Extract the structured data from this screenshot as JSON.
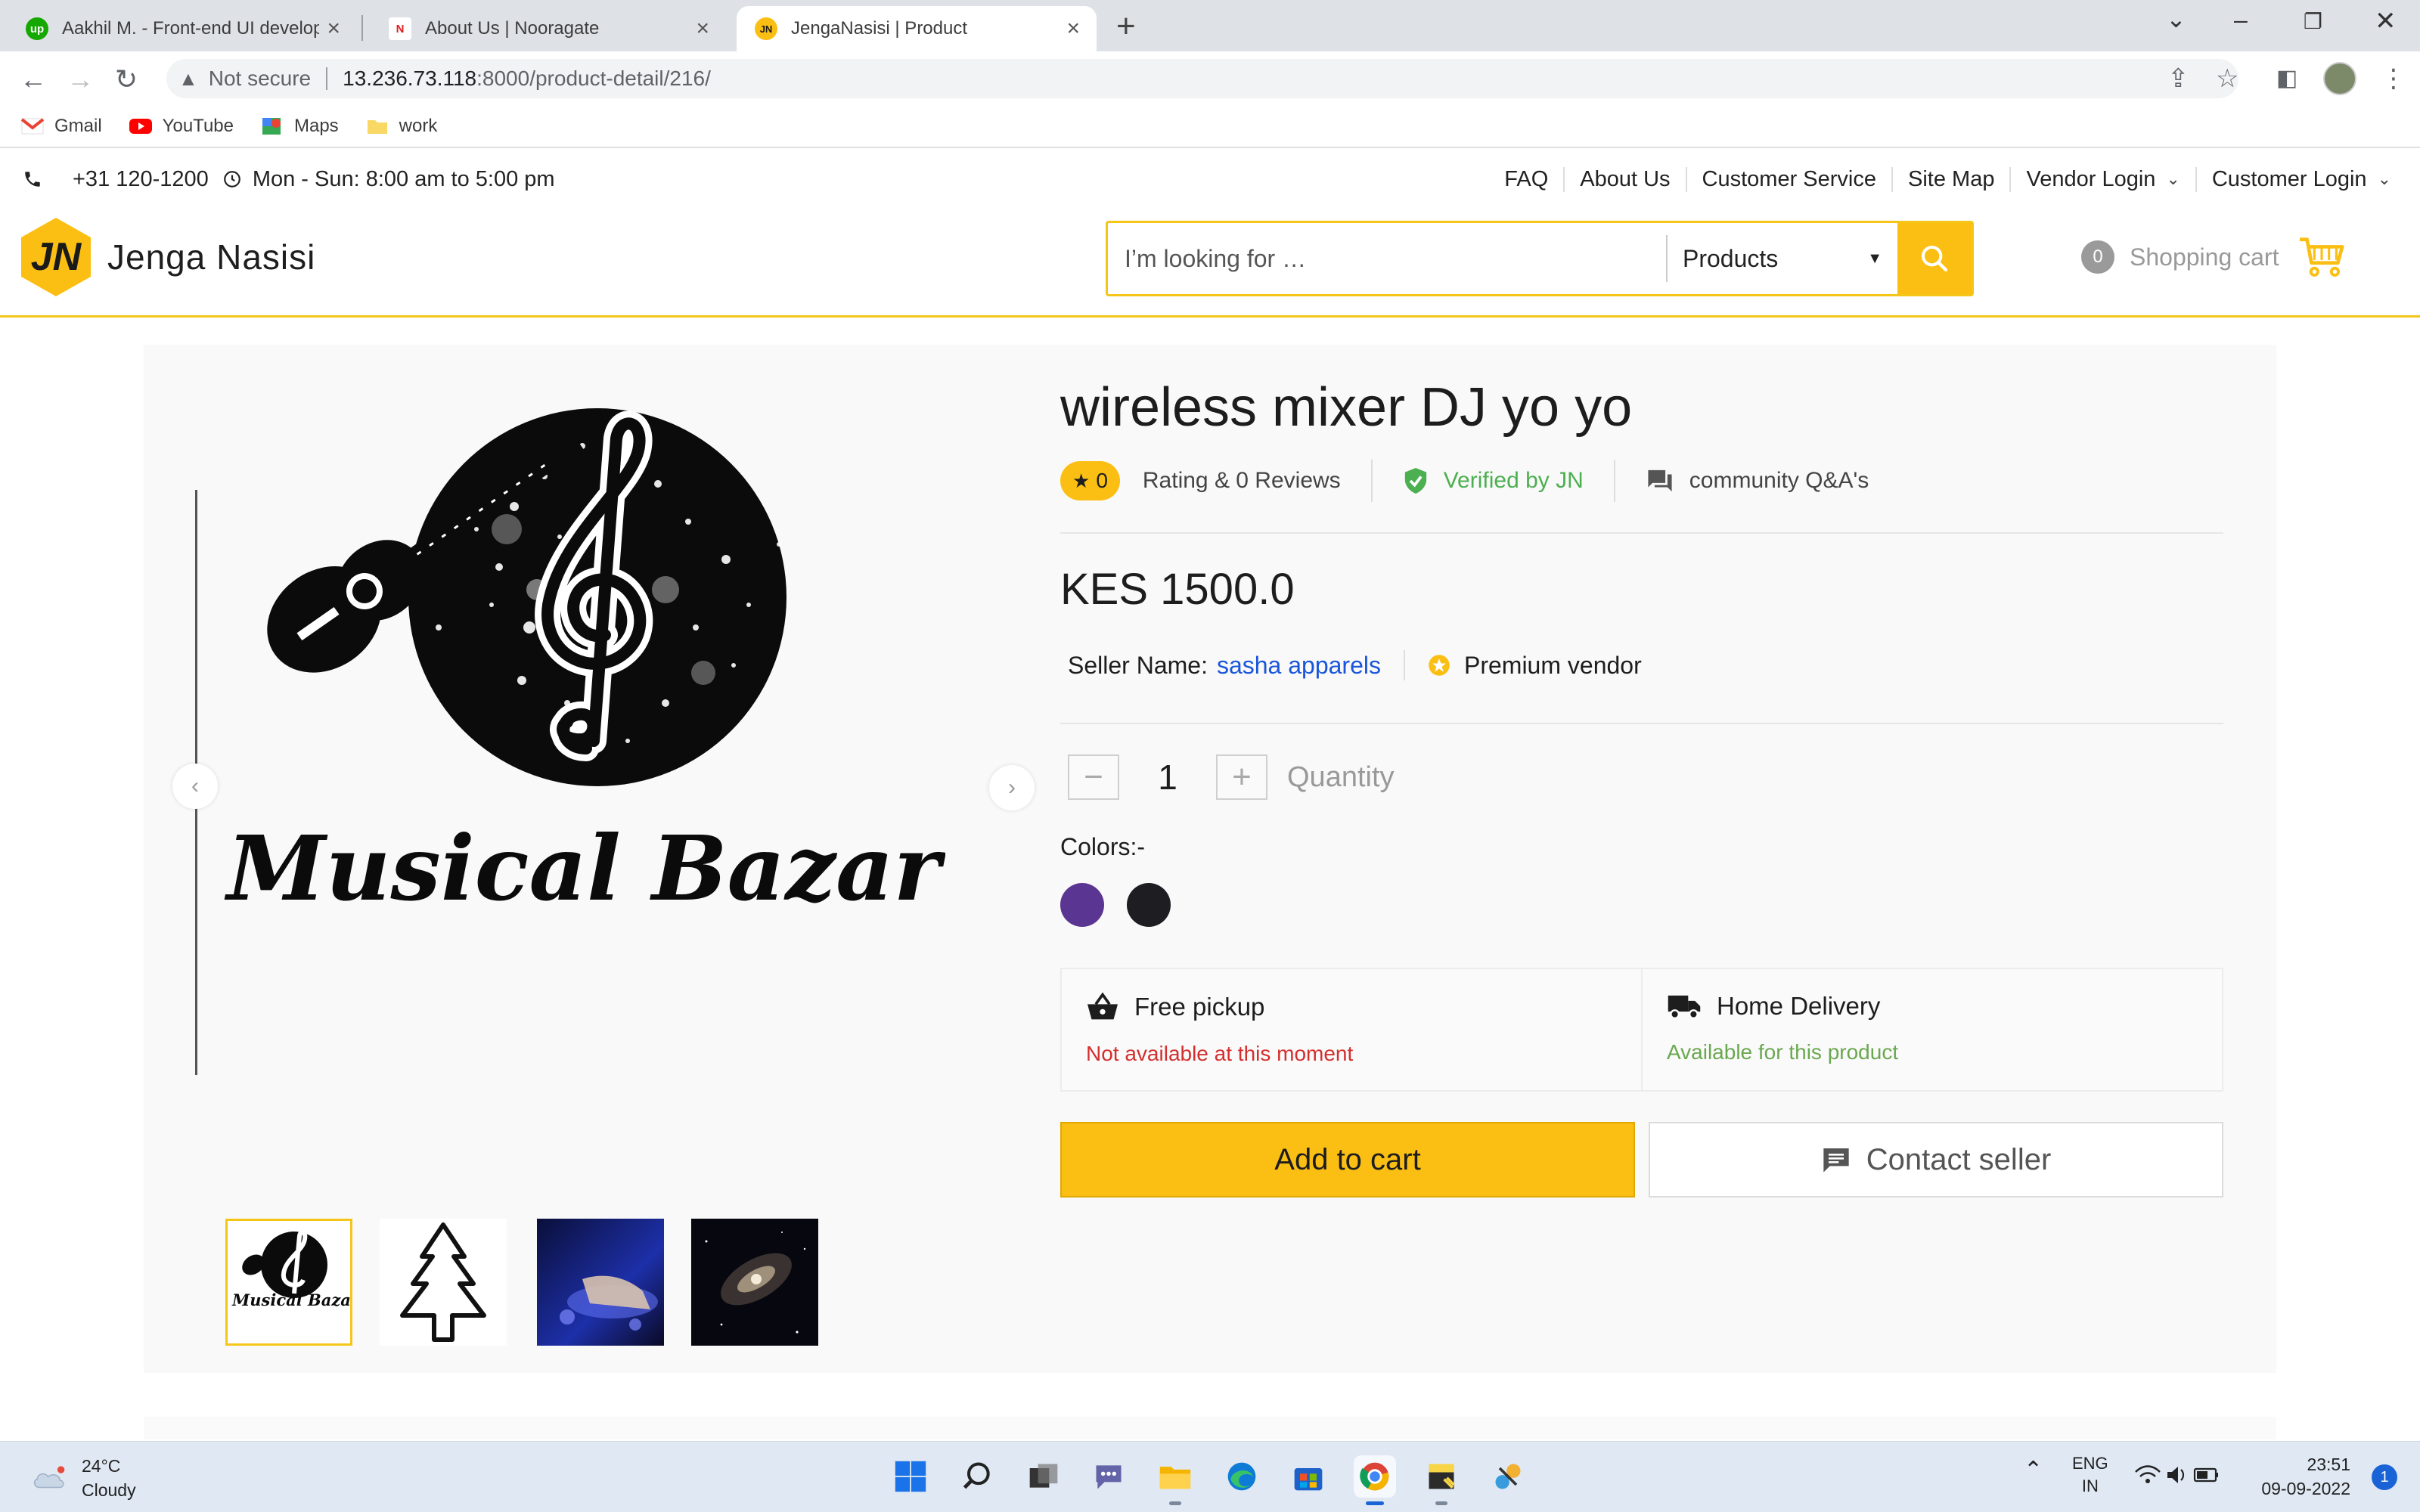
{
  "browser": {
    "tabs": [
      {
        "title": "Aakhil M. - Front-end UI develop",
        "favicon": "up",
        "favicon_color": "#14a800"
      },
      {
        "title": "About Us | Nooragate",
        "favicon": "N",
        "favicon_color": "#e02020"
      },
      {
        "title": "JengaNasisi | Product",
        "favicon": "JN",
        "favicon_color": "#fbbf14"
      }
    ],
    "security_label": "Not secure",
    "url_host": "13.236.73.118",
    "url_rest": ":8000/product-detail/216/",
    "bookmarks": [
      "Gmail",
      "YouTube",
      "Maps",
      "work"
    ]
  },
  "site": {
    "phone": "+31 120-1200",
    "hours": "Mon - Sun: 8:00 am to 5:00 pm",
    "top_links": [
      "FAQ",
      "About Us",
      "Customer Service",
      "Site Map",
      "Vendor Login",
      "Customer Login"
    ],
    "logo_mark": "JN",
    "brand": "Jenga Nasisi",
    "search_placeholder": "I’m looking for …",
    "search_category": "Products",
    "cart_count": "0",
    "cart_label": "Shopping cart",
    "accent": "#fbbf14"
  },
  "product": {
    "title": "wireless mixer DJ yo yo",
    "rating_value": "0",
    "rating_text": "Rating & 0 Reviews",
    "verified_text": "Verified by JN",
    "qa_text": "community Q&A's",
    "price": "KES 1500.0",
    "seller_label": "Seller Name:",
    "seller_name": "sasha apparels",
    "vendor_badge": "Premium vendor",
    "quantity": "1",
    "quantity_label": "Quantity",
    "colors_label": "Colors:-",
    "colors": [
      "#5b3592",
      "#1e1e22"
    ],
    "main_image_text": "Musical Bazar",
    "thumb_logo_text": "Musical Bazar",
    "pickup_title": "Free pickup",
    "pickup_status": "Not available at this moment",
    "pickup_color": "#d32f2f",
    "delivery_title": "Home Delivery",
    "delivery_status": "Available for this product",
    "delivery_color": "#6aa84f",
    "add_to_cart": "Add to cart",
    "contact_seller": "Contact seller"
  },
  "taskbar": {
    "temperature": "24°C",
    "weather": "Cloudy",
    "lang_line1": "ENG",
    "lang_line2": "IN",
    "time": "23:51",
    "date": "09-09-2022",
    "notifications": "1"
  }
}
